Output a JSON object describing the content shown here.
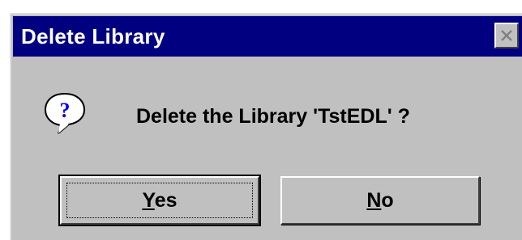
{
  "window": {
    "title": "Delete Library",
    "close_label": "X"
  },
  "message": {
    "icon": "question-icon",
    "text": "Delete the Library 'TstEDL' ?"
  },
  "buttons": {
    "yes": {
      "label_first": "Y",
      "label_rest": "es",
      "default": true
    },
    "no": {
      "label_first": "N",
      "label_rest": "o",
      "default": false
    }
  },
  "colors": {
    "titlebar": "#000080",
    "dialog_face": "#c0c0c0",
    "title_text": "#ffffff"
  }
}
